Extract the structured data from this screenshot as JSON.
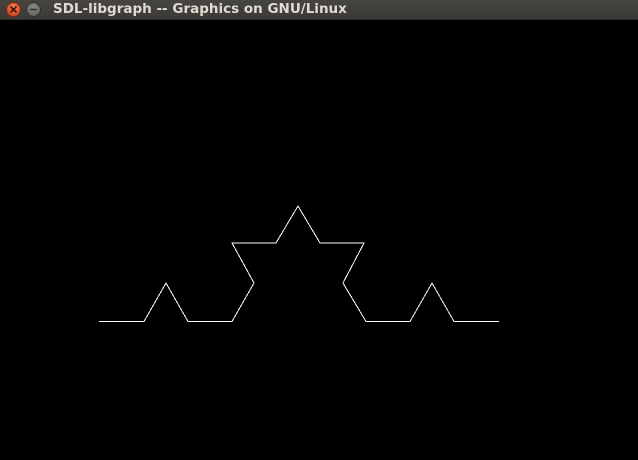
{
  "window": {
    "title": "SDL-libgraph -- Graphics on GNU/Linux",
    "close_button_icon": "close-icon",
    "minimize_button_icon": "minimize-icon"
  },
  "canvas": {
    "background_color": "#000000",
    "stroke_color": "#ffffff",
    "drawing": "koch-curve"
  }
}
